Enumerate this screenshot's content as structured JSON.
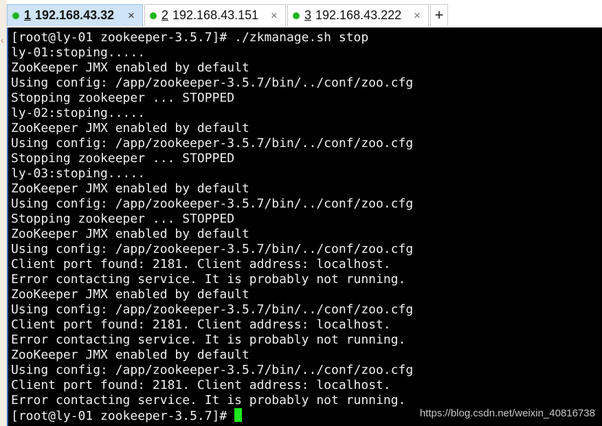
{
  "tabs": [
    {
      "number": "1",
      "host": "192.168.43.32",
      "close": "×",
      "status_color": "#1fb41f",
      "active": true
    },
    {
      "number": "2",
      "host": "192.168.43.151",
      "close": "×",
      "status_color": "#1fb41f",
      "active": false
    },
    {
      "number": "3",
      "host": "192.168.43.222",
      "close": "×",
      "status_color": "#1fb41f",
      "active": false
    }
  ],
  "new_tab_label": "+",
  "terminal": {
    "lines": [
      "[root@ly-01 zookeeper-3.5.7]# ./zkmanage.sh stop",
      "ly-01:stoping.....",
      "ZooKeeper JMX enabled by default",
      "Using config: /app/zookeeper-3.5.7/bin/../conf/zoo.cfg",
      "Stopping zookeeper ... STOPPED",
      "ly-02:stoping.....",
      "ZooKeeper JMX enabled by default",
      "Using config: /app/zookeeper-3.5.7/bin/../conf/zoo.cfg",
      "Stopping zookeeper ... STOPPED",
      "ly-03:stoping.....",
      "ZooKeeper JMX enabled by default",
      "Using config: /app/zookeeper-3.5.7/bin/../conf/zoo.cfg",
      "Stopping zookeeper ... STOPPED",
      "ZooKeeper JMX enabled by default",
      "Using config: /app/zookeeper-3.5.7/bin/../conf/zoo.cfg",
      "Client port found: 2181. Client address: localhost.",
      "Error contacting service. It is probably not running.",
      "ZooKeeper JMX enabled by default",
      "Using config: /app/zookeeper-3.5.7/bin/../conf/zoo.cfg",
      "Client port found: 2181. Client address: localhost.",
      "Error contacting service. It is probably not running.",
      "ZooKeeper JMX enabled by default",
      "Using config: /app/zookeeper-3.5.7/bin/../conf/zoo.cfg",
      "Client port found: 2181. Client address: localhost.",
      "Error contacting service. It is probably not running."
    ],
    "prompt": "[root@ly-01 zookeeper-3.5.7]# ",
    "cursor_color": "#1ee81e",
    "background": "#000000",
    "text_color": "#f0f0f0"
  },
  "watermark": "https://blog.csdn.net/weixin_40816738"
}
